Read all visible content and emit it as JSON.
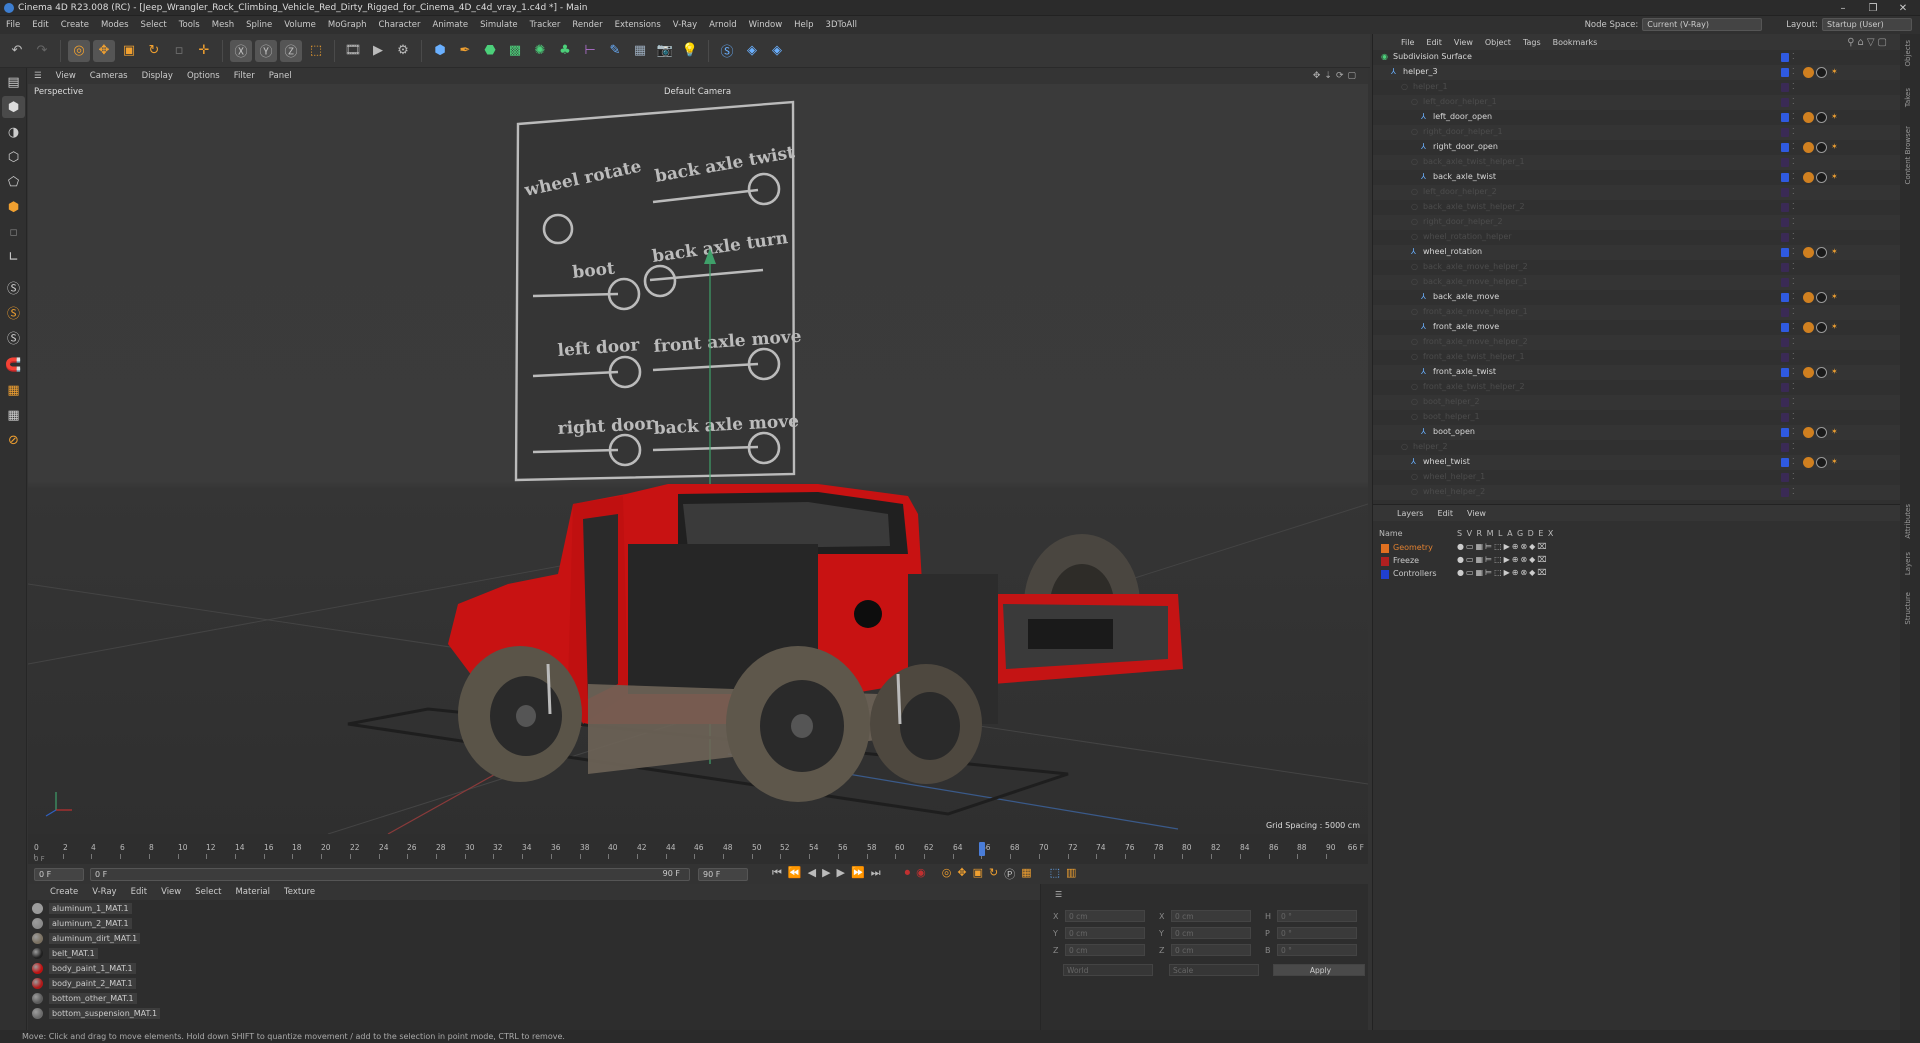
{
  "window": {
    "title": "Cinema 4D R23.008 (RC) - [Jeep_Wrangler_Rock_Climbing_Vehicle_Red_Dirty_Rigged_for_Cinema_4D_c4d_vray_1.c4d *] - Main"
  },
  "menubar": {
    "items": [
      "File",
      "Edit",
      "Create",
      "Modes",
      "Select",
      "Tools",
      "Mesh",
      "Spline",
      "Volume",
      "MoGraph",
      "Character",
      "Animate",
      "Simulate",
      "Tracker",
      "Render",
      "Extensions",
      "V-Ray",
      "Arnold",
      "Window",
      "Help",
      "3DToAll"
    ],
    "node_space_label": "Node Space:",
    "node_space_value": "Current (V-Ray)",
    "layout_label": "Layout:",
    "layout_value": "Startup (User)"
  },
  "viewport": {
    "menu": [
      "View",
      "Cameras",
      "Display",
      "Options",
      "Filter",
      "Panel"
    ],
    "projection": "Perspective",
    "camera": "Default Camera",
    "grid_spacing": "Grid Spacing : 5000 cm",
    "board_labels": [
      "wheel rotate",
      "back axle twist",
      "boot",
      "back axle turn",
      "left door",
      "front axle move",
      "right door",
      "back axle move"
    ]
  },
  "timeline": {
    "ticks": [
      "0",
      "2",
      "4",
      "6",
      "8",
      "10",
      "12",
      "14",
      "16",
      "18",
      "20",
      "22",
      "24",
      "26",
      "28",
      "30",
      "32",
      "34",
      "36",
      "38",
      "40",
      "42",
      "44",
      "46",
      "48",
      "50",
      "52",
      "54",
      "56",
      "58",
      "60",
      "62",
      "64",
      "66",
      "68",
      "70",
      "72",
      "74",
      "76",
      "78",
      "80",
      "82",
      "84",
      "86",
      "88",
      "90"
    ],
    "end_frame": "0 F",
    "current_frame": "66 F",
    "start": "0 F",
    "range_start": "0 F",
    "range_end": "90 F",
    "max": "90 F",
    "playhead": 66,
    "total": 90
  },
  "materials": {
    "menu": [
      "Create",
      "V-Ray",
      "Edit",
      "View",
      "Select",
      "Material",
      "Texture"
    ],
    "items": [
      {
        "name": "aluminum_1_MAT.1",
        "color": "#9a9a9a"
      },
      {
        "name": "aluminum_2_MAT.1",
        "color": "#8a8a8a"
      },
      {
        "name": "aluminum_dirt_MAT.1",
        "color": "#7a7060"
      },
      {
        "name": "belt_MAT.1",
        "color": "#202020"
      },
      {
        "name": "body_paint_1_MAT.1",
        "color": "#c01010"
      },
      {
        "name": "body_paint_2_MAT.1",
        "color": "#b01818"
      },
      {
        "name": "bottom_other_MAT.1",
        "color": "#5a5a5a"
      },
      {
        "name": "bottom_suspension_MAT.1",
        "color": "#6a6a6a"
      }
    ]
  },
  "attributes": {
    "labels": [
      "X",
      "Y",
      "Z",
      "X",
      "Y",
      "Z",
      "H",
      "P",
      "B"
    ],
    "values": [
      "0 cm",
      "0 cm",
      "0 cm",
      "0 cm",
      "0 cm",
      "0 cm",
      "0 °",
      "0 °",
      "0 °"
    ],
    "world": "World",
    "scale": "Scale",
    "apply": "Apply"
  },
  "statusbar": {
    "text": "Move: Click and drag to move elements. Hold down SHIFT to quantize movement / add to the selection in point mode, CTRL to remove."
  },
  "objects": {
    "menu": [
      "File",
      "Edit",
      "View",
      "Object",
      "Tags",
      "Bookmarks"
    ],
    "rows": [
      {
        "name": "Subdivision Surface",
        "indent": 0,
        "dim": false,
        "tags": false
      },
      {
        "name": "helper_3",
        "indent": 1,
        "dim": false,
        "tags": true
      },
      {
        "name": "helper_1",
        "indent": 2,
        "dim": true,
        "tags": false
      },
      {
        "name": "left_door_helper_1",
        "indent": 3,
        "dim": true,
        "tags": false
      },
      {
        "name": "left_door_open",
        "indent": 4,
        "dim": false,
        "tags": true
      },
      {
        "name": "right_door_helper_1",
        "indent": 3,
        "dim": true,
        "tags": false
      },
      {
        "name": "right_door_open",
        "indent": 4,
        "dim": false,
        "tags": true
      },
      {
        "name": "back_axle_twist_helper_1",
        "indent": 3,
        "dim": true,
        "tags": false
      },
      {
        "name": "back_axle_twist",
        "indent": 4,
        "dim": false,
        "tags": true
      },
      {
        "name": "left_door_helper_2",
        "indent": 3,
        "dim": true,
        "tags": false
      },
      {
        "name": "back_axle_twist_helper_2",
        "indent": 3,
        "dim": true,
        "tags": false
      },
      {
        "name": "right_door_helper_2",
        "indent": 3,
        "dim": true,
        "tags": false
      },
      {
        "name": "wheel_rotation_helper",
        "indent": 3,
        "dim": true,
        "tags": false
      },
      {
        "name": "wheel_rotation",
        "indent": 3,
        "dim": false,
        "tags": true
      },
      {
        "name": "back_axle_move_helper_2",
        "indent": 3,
        "dim": true,
        "tags": false
      },
      {
        "name": "back_axle_move_helper_1",
        "indent": 3,
        "dim": true,
        "tags": false
      },
      {
        "name": "back_axle_move",
        "indent": 4,
        "dim": false,
        "tags": true
      },
      {
        "name": "front_axle_move_helper_1",
        "indent": 3,
        "dim": true,
        "tags": false
      },
      {
        "name": "front_axle_move",
        "indent": 4,
        "dim": false,
        "tags": true
      },
      {
        "name": "front_axle_move_helper_2",
        "indent": 3,
        "dim": true,
        "tags": false
      },
      {
        "name": "front_axle_twist_helper_1",
        "indent": 3,
        "dim": true,
        "tags": false
      },
      {
        "name": "front_axle_twist",
        "indent": 4,
        "dim": false,
        "tags": true
      },
      {
        "name": "front_axle_twist_helper_2",
        "indent": 3,
        "dim": true,
        "tags": false
      },
      {
        "name": "boot_helper_2",
        "indent": 3,
        "dim": true,
        "tags": false
      },
      {
        "name": "boot_helper_1",
        "indent": 3,
        "dim": true,
        "tags": false
      },
      {
        "name": "boot_open",
        "indent": 4,
        "dim": false,
        "tags": true
      },
      {
        "name": "helper_2",
        "indent": 2,
        "dim": true,
        "tags": false
      },
      {
        "name": "wheel_twist",
        "indent": 3,
        "dim": false,
        "tags": true
      },
      {
        "name": "wheel_helper_1",
        "indent": 3,
        "dim": true,
        "tags": false
      },
      {
        "name": "wheel_helper_2",
        "indent": 3,
        "dim": true,
        "tags": false
      }
    ]
  },
  "layers": {
    "menu": [
      "Layers",
      "Edit",
      "View"
    ],
    "header": {
      "name": "Name",
      "cols": [
        "S",
        "V",
        "R",
        "M",
        "L",
        "A",
        "G",
        "D",
        "E",
        "X"
      ]
    },
    "rows": [
      {
        "name": "Geometry",
        "color": "#e07020",
        "name_color": "#e08030"
      },
      {
        "name": "Freeze",
        "color": "#b02020",
        "name_color": "#cccccc"
      },
      {
        "name": "Controllers",
        "color": "#2040d0",
        "name_color": "#cccccc"
      }
    ]
  },
  "side_tabs": [
    "Objects",
    "Takes",
    "Content Browser",
    "Attributes",
    "Layers",
    "Structure"
  ],
  "colors": {
    "accent": "#4a7dd8",
    "jeep_red": "#d41414",
    "selection": "#4a90e2"
  }
}
